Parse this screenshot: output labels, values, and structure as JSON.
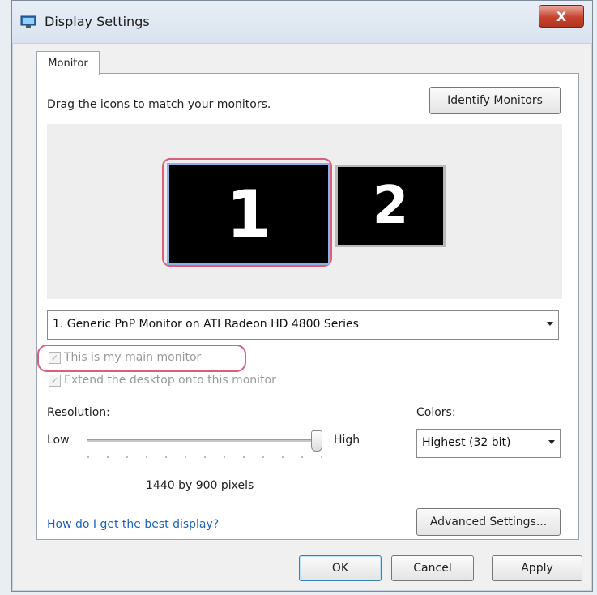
{
  "window": {
    "title": "Display Settings",
    "close_glyph": "X"
  },
  "tabs": [
    {
      "label": "Monitor"
    }
  ],
  "instructions": "Drag the icons to match your monitors.",
  "buttons": {
    "identify": "Identify Monitors",
    "advanced": "Advanced Settings...",
    "ok": "OK",
    "cancel": "Cancel",
    "apply": "Apply"
  },
  "monitors": [
    {
      "number": "1"
    },
    {
      "number": "2"
    }
  ],
  "monitor_select": {
    "value": "1. Generic PnP Monitor on ATI Radeon HD 4800 Series"
  },
  "checkboxes": {
    "main": {
      "label": "This is my main monitor",
      "checked": true
    },
    "extend": {
      "label": "Extend the desktop onto this monitor",
      "checked": true
    }
  },
  "resolution": {
    "label": "Resolution:",
    "low": "Low",
    "high": "High",
    "value_text": "1440 by 900 pixels",
    "slider_level": 1.0
  },
  "colors": {
    "label": "Colors:",
    "value": "Highest (32 bit)"
  },
  "help_link": "How do I get the best display?",
  "icons": {
    "app": "display-settings-icon",
    "dropdown": "chevron-down-icon"
  },
  "highlight_color": "#d9607c"
}
